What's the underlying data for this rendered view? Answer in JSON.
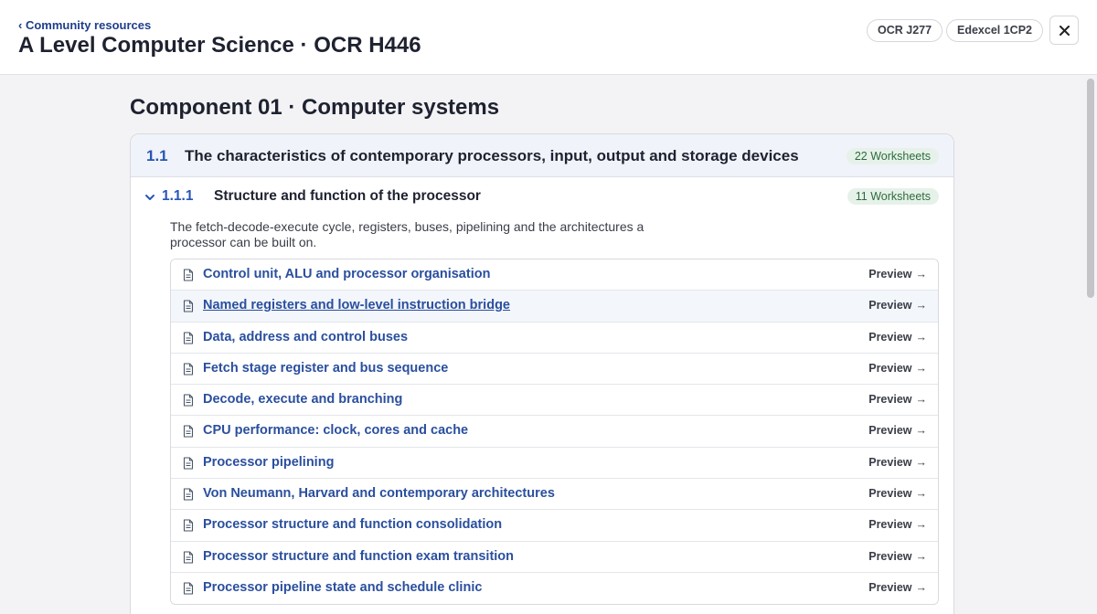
{
  "header": {
    "back_label": "‹ Community resources",
    "title": "A Level Computer Science · OCR H446",
    "pills": [
      "OCR J277",
      "Edexcel 1CP2"
    ],
    "close_icon": "close-icon"
  },
  "component": {
    "title": "Component 01 · Computer systems"
  },
  "section": {
    "number": "1.1",
    "title": "The characteristics of contemporary processors, input, output and storage devices",
    "count": "22 Worksheets"
  },
  "subsection": {
    "number": "1.1.1",
    "title": "Structure and function of the processor",
    "count": "11 Worksheets",
    "description": "The fetch-decode-execute cycle, registers, buses, pipelining and the architectures a processor can be built on."
  },
  "worksheets": [
    {
      "title": "Control unit, ALU and processor organisation",
      "preview": "Preview"
    },
    {
      "title": "Named registers and low-level instruction bridge",
      "preview": "Preview"
    },
    {
      "title": "Data, address and control buses",
      "preview": "Preview"
    },
    {
      "title": "Fetch stage register and bus sequence",
      "preview": "Preview"
    },
    {
      "title": "Decode, execute and branching",
      "preview": "Preview"
    },
    {
      "title": "CPU performance: clock, cores and cache",
      "preview": "Preview"
    },
    {
      "title": "Processor pipelining",
      "preview": "Preview"
    },
    {
      "title": "Von Neumann, Harvard and contemporary architectures",
      "preview": "Preview"
    },
    {
      "title": "Processor structure and function consolidation",
      "preview": "Preview"
    },
    {
      "title": "Processor structure and function exam transition",
      "preview": "Preview"
    },
    {
      "title": "Processor pipeline state and schedule clinic",
      "preview": "Preview"
    }
  ],
  "colors": {
    "accent": "#2756b5",
    "link": "#2a4f9e",
    "badge_bg": "#e6f2e9",
    "badge_text": "#2e6a3f"
  }
}
